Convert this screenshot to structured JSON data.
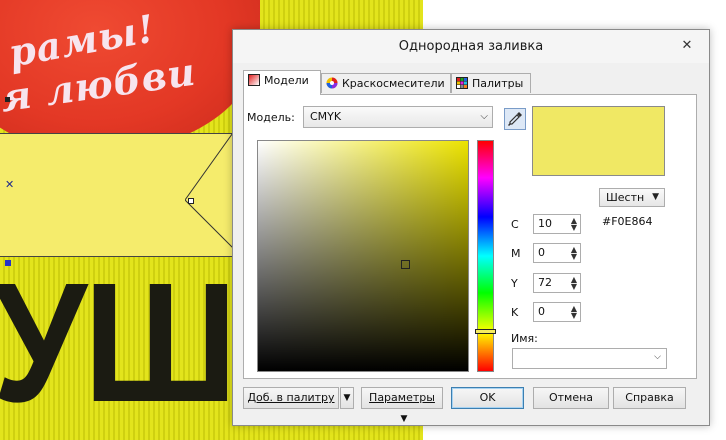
{
  "canvas": {
    "text_line1": "рамы!",
    "text_line2": "я любви",
    "big_text": "УШК"
  },
  "dialog": {
    "title": "Однородная заливка",
    "close_glyph": "✕",
    "tabs": [
      {
        "label": "Модели",
        "active": true,
        "icon": "models-icon"
      },
      {
        "label": "Краскосмесители",
        "active": false,
        "icon": "color-wheel-icon"
      },
      {
        "label": "Палитры",
        "active": false,
        "icon": "palette-grid-icon"
      }
    ],
    "model_label": "Модель:",
    "model_value": "CMYK",
    "hex_format": "Шестн",
    "hex_value": "#F0E864",
    "swatch_color": "#F0E864",
    "channels": [
      {
        "label": "C",
        "value": "10"
      },
      {
        "label": "M",
        "value": "0"
      },
      {
        "label": "Y",
        "value": "72"
      },
      {
        "label": "K",
        "value": "0"
      }
    ],
    "name_label": "Имя:",
    "name_value": "",
    "buttons": {
      "add_palette": "Доб. в палитру",
      "params": "Параметры",
      "ok": "OK",
      "cancel": "Отмена",
      "help": "Справка"
    }
  }
}
